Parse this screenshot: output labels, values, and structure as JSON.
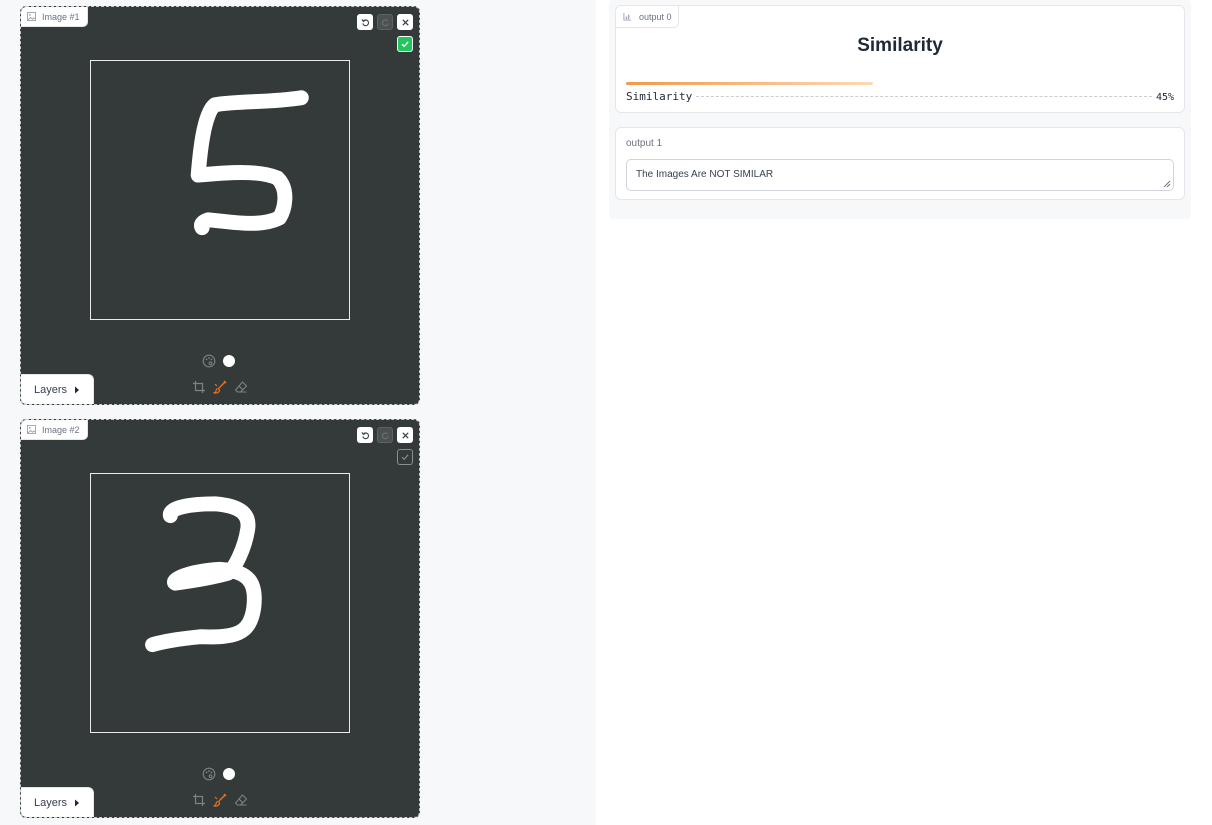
{
  "editors": [
    {
      "label": "Image #1",
      "digit": "5",
      "confirmed": true,
      "layers_label": "Layers",
      "brush_color": "#ffffff"
    },
    {
      "label": "Image #2",
      "digit": "3",
      "confirmed": false,
      "layers_label": "Layers",
      "brush_color": "#ffffff"
    }
  ],
  "output0": {
    "badge": "output 0",
    "title": "Similarity",
    "label_name": "Similarity",
    "confidence_text": "45%",
    "confidence_value": 0.45,
    "bar_color_start": "#f2994a",
    "bar_color_end": "#fcd9b6"
  },
  "output1": {
    "label": "output 1",
    "value": "The Images Are NOT SIMILAR"
  },
  "colors": {
    "editor_bg": "#333a39",
    "accent": "#f97316",
    "check_green": "#22c55e"
  }
}
